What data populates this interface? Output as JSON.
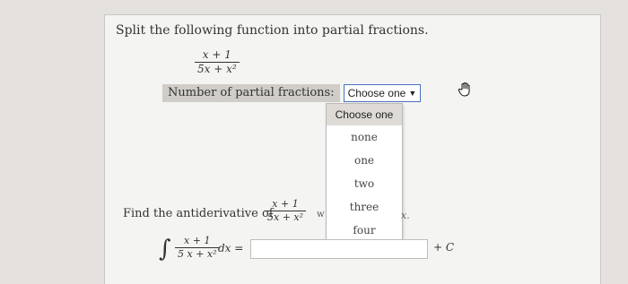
{
  "prompt": "Split the following function into partial fractions.",
  "function": {
    "numerator": "x + 1",
    "denominator": "5x + x²"
  },
  "partial_fractions": {
    "label": "Number of partial fractions:",
    "selected": "Choose one",
    "options": [
      "Choose one",
      "none",
      "one",
      "two",
      "three",
      "four"
    ]
  },
  "antiderivative": {
    "label": "Find the antiderivative of",
    "numerator": "x + 1",
    "denominator": "5x + x²",
    "trailing_mark": "w",
    "trailing_var": "x."
  },
  "integral": {
    "symbol": "∫",
    "numerator": "x + 1",
    "denominator": "5 x + x²",
    "dx": "dx =",
    "answer_value": "",
    "constant": "+ C"
  },
  "icons": {
    "cursor": "hand-pointer-icon"
  }
}
